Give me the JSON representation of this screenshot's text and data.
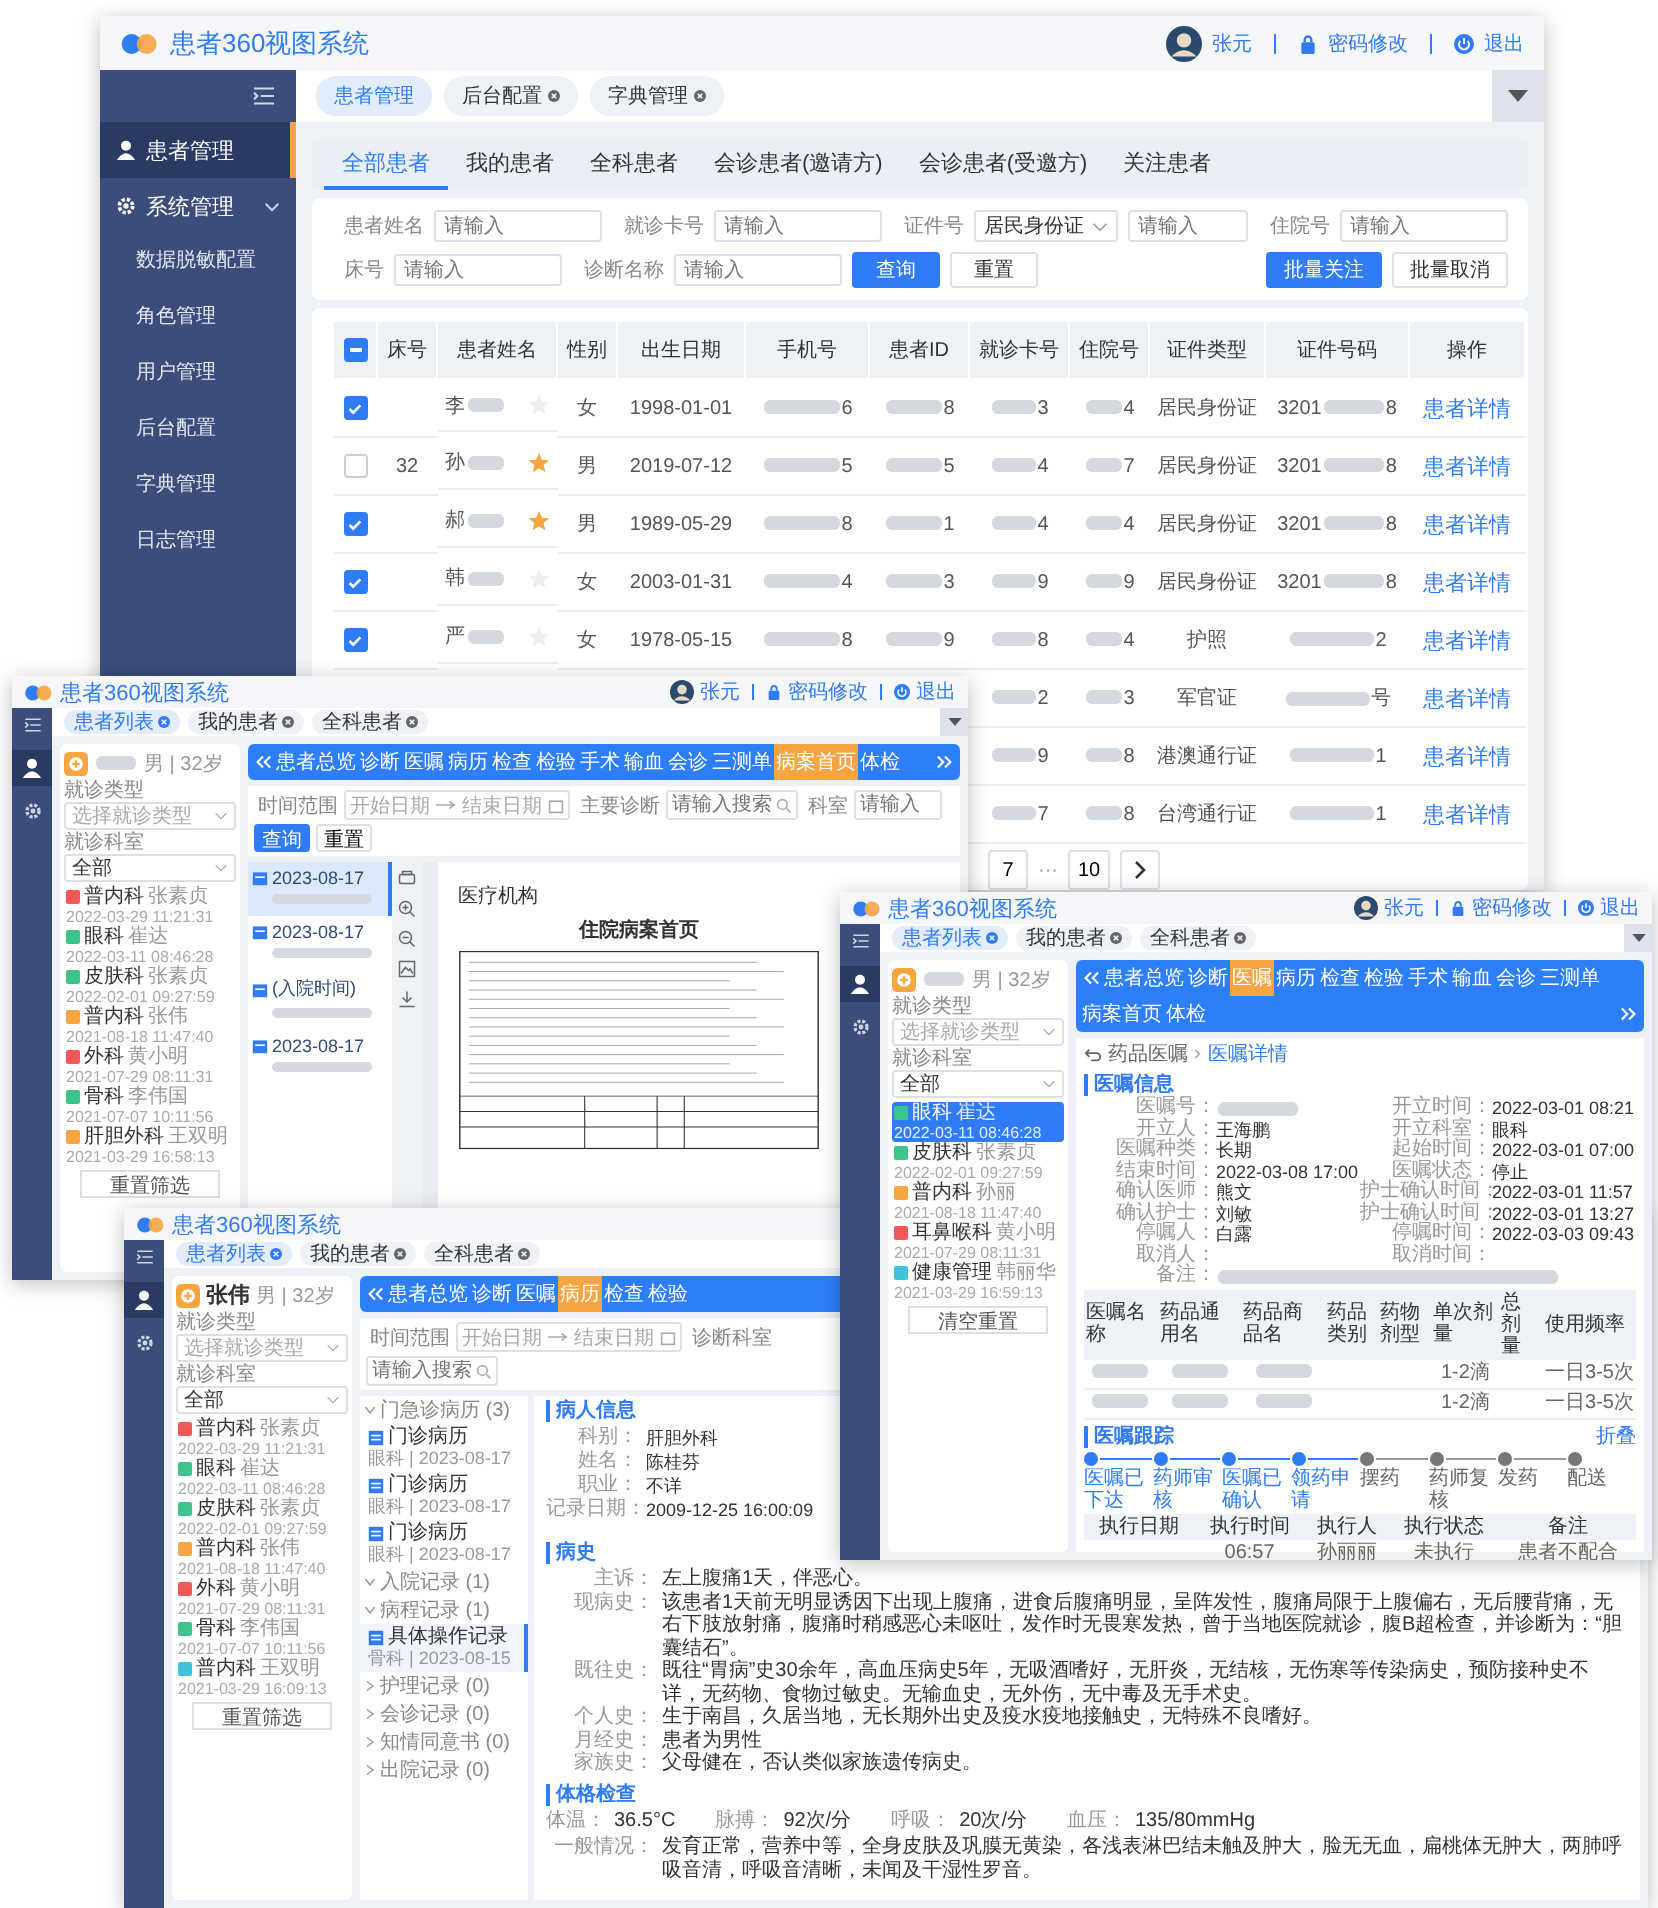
{
  "main_window": {
    "title": "患者360视图系统",
    "user": {
      "name": "张元",
      "links": [
        {
          "label": "密码修改",
          "kind": "password"
        },
        {
          "label": "退出",
          "kind": "logout"
        }
      ]
    },
    "sidebar": [
      {
        "label": "患者管理",
        "kind": "user",
        "selected": true
      },
      {
        "label": "系统管理",
        "kind": "gear",
        "selected": false,
        "expanded": true,
        "children": [
          {
            "label": "数据脱敏配置",
            "selected": false
          },
          {
            "label": "角色管理",
            "selected": false
          },
          {
            "label": "用户管理",
            "selected": false
          },
          {
            "label": "后台配置",
            "selected": false
          },
          {
            "label": "字典管理",
            "selected": false
          },
          {
            "label": "日志管理",
            "selected": false
          }
        ]
      }
    ],
    "tabs": [
      {
        "label": "患者管理",
        "selected": true,
        "closable": false
      },
      {
        "label": "后台配置",
        "selected": false,
        "closable": true
      },
      {
        "label": "字典管理",
        "selected": false,
        "closable": true
      }
    ],
    "subtabs": [
      {
        "label": "全部患者",
        "selected": true
      },
      {
        "label": "我的患者",
        "selected": false
      },
      {
        "label": "全科患者",
        "selected": false
      },
      {
        "label": "会诊患者(邀请方)",
        "selected": false
      },
      {
        "label": "会诊患者(受邀方)",
        "selected": false
      },
      {
        "label": "关注患者",
        "selected": false
      }
    ],
    "filter_rows": [
      [
        {
          "label": "患者姓名",
          "placeholder": "请输入"
        },
        {
          "label": "就诊卡号",
          "placeholder": "请输入"
        },
        {
          "label": "证件号",
          "select": "居民身份证",
          "placeholder": "请输入"
        },
        {
          "label": "住院号",
          "placeholder": "请输入"
        }
      ],
      [
        {
          "label": "床号",
          "placeholder": "请输入"
        },
        {
          "label": "诊断名称",
          "placeholder": "请输入"
        }
      ]
    ],
    "buttons": [
      {
        "label": "查询",
        "kind": "primary"
      },
      {
        "label": "重置",
        "kind": "plain"
      }
    ],
    "bulk_buttons": [
      {
        "label": "批量关注",
        "kind": "primary"
      },
      {
        "label": "批量取消",
        "kind": "plain"
      }
    ],
    "table": {
      "select_all_indeterminate": true,
      "columns": [
        "床号",
        "患者姓名",
        "性别",
        "出生日期",
        "手机号",
        "患者ID",
        "就诊卡号",
        "住院号",
        "证件类型",
        "证件号码",
        "操作"
      ],
      "rows": [
        {
          "checked": true,
          "name": "李",
          "starred": false,
          "gender": "女",
          "birth": "1998-01-01",
          "phone": "6",
          "pid": "8",
          "card": "3",
          "inpatient": "4",
          "id_type": "居民身份证",
          "id_pre": "3201",
          "id_suf": "8",
          "action": "患者详情"
        },
        {
          "checked": false,
          "bed": "32",
          "name": "孙",
          "starred": true,
          "gender": "男",
          "birth": "2019-07-12",
          "phone": "5",
          "pid": "5",
          "card": "4",
          "inpatient": "7",
          "id_type": "居民身份证",
          "id_pre": "3201",
          "id_suf": "8",
          "action": "患者详情"
        },
        {
          "checked": true,
          "name": "郝",
          "starred": true,
          "gender": "男",
          "birth": "1989-05-29",
          "phone": "8",
          "pid": "1",
          "card": "4",
          "inpatient": "4",
          "id_type": "居民身份证",
          "id_pre": "3201",
          "id_suf": "8",
          "action": "患者详情"
        },
        {
          "checked": true,
          "name": "韩",
          "starred": false,
          "gender": "女",
          "birth": "2003-01-31",
          "phone": "4",
          "pid": "3",
          "card": "9",
          "inpatient": "9",
          "id_type": "居民身份证",
          "id_pre": "3201",
          "id_suf": "8",
          "action": "患者详情"
        },
        {
          "checked": true,
          "name": "严",
          "starred": false,
          "gender": "女",
          "birth": "1978-05-15",
          "phone": "8",
          "pid": "9",
          "card": "8",
          "inpatient": "4",
          "id_type": "护照",
          "id_suf": "2",
          "action": "患者详情"
        },
        {
          "card": "2",
          "inpatient": "3",
          "id_type": "军官证",
          "id_suf": "号",
          "action": "患者详情"
        },
        {
          "card": "9",
          "inpatient": "8",
          "id_type": "港澳通行证",
          "id_suf": "1",
          "action": "患者详情"
        },
        {
          "card": "7",
          "inpatient": "8",
          "id_type": "台湾通行证",
          "id_suf": "1",
          "action": "患者详情"
        }
      ]
    },
    "pagination": [
      {
        "label": "7",
        "kind": "page"
      },
      {
        "label": "···",
        "kind": "ellipsis"
      },
      {
        "label": "10",
        "kind": "page"
      }
    ]
  },
  "sub_windows": [
    {
      "kind": "front_page",
      "title": "患者360视图系统",
      "user": "张元",
      "links": [
        {
          "label": "密码修改",
          "kind": "password"
        },
        {
          "label": "退出",
          "kind": "logout"
        }
      ],
      "tabs": [
        {
          "label": "患者列表",
          "selected": true
        },
        {
          "label": "我的患者",
          "selected": false
        },
        {
          "label": "全科患者",
          "selected": false
        }
      ],
      "patient": {
        "info": "男 | 32岁"
      },
      "visit_filters": [
        {
          "label": "就诊类型",
          "placeholder": "选择就诊类型"
        },
        {
          "label": "就诊科室",
          "value": "全部"
        }
      ],
      "visits": [
        {
          "dept": "普内科",
          "doctor": "张素贞",
          "time": "2022-03-29 11:21:31",
          "color": "#f25858",
          "selected": false
        },
        {
          "dept": "眼科",
          "doctor": "崔达",
          "time": "2022-03-11 08:46:28",
          "color": "#3cc48a",
          "selected": false
        },
        {
          "dept": "皮肤科",
          "doctor": "张素贞",
          "time": "2022-02-01 09:27:59",
          "color": "#3cc48a",
          "selected": false
        },
        {
          "dept": "普内科",
          "doctor": "张伟",
          "time": "2021-08-18 11:47:40",
          "color": "#f7a541",
          "selected": false
        },
        {
          "dept": "外科",
          "doctor": "黄小明",
          "time": "2021-07-29 08:11:31",
          "color": "#f25858",
          "selected": false
        },
        {
          "dept": "骨科",
          "doctor": "李伟国",
          "time": "2021-07-07 10:11:56",
          "color": "#3cc48a",
          "selected": false
        },
        {
          "dept": "肝胆外科",
          "doctor": "王双明",
          "time": "2021-03-29 16:58:13",
          "color": "#f7a541",
          "selected": false
        }
      ],
      "reset": "重置筛选",
      "scroll_prev": true,
      "scroll_next": true,
      "nav": [
        {
          "label": "患者总览",
          "selected": false
        },
        {
          "label": "诊断",
          "selected": false
        },
        {
          "label": "医嘱",
          "selected": false
        },
        {
          "label": "病历",
          "selected": false
        },
        {
          "label": "检查",
          "selected": false
        },
        {
          "label": "检验",
          "selected": false
        },
        {
          "label": "手术",
          "selected": false
        },
        {
          "label": "输血",
          "selected": false
        },
        {
          "label": "会诊",
          "selected": false
        },
        {
          "label": "三测单",
          "selected": false
        },
        {
          "label": "病案首页",
          "selected": true
        },
        {
          "label": "体检",
          "selected": false
        }
      ],
      "filters": [
        {
          "label": "时间范围",
          "kind": "range",
          "start": "开始日期",
          "end": "结束日期"
        },
        {
          "label": "主要诊断",
          "kind": "search",
          "placeholder": "请输入搜索"
        },
        {
          "label": "科室",
          "kind": "text",
          "placeholder": "请输入"
        }
      ],
      "actions": [
        {
          "label": "查询",
          "kind": "primary"
        },
        {
          "label": "重置",
          "kind": "plain"
        }
      ],
      "records": [
        {
          "date": "2023-08-17",
          "selected": true
        },
        {
          "date": "2023-08-17",
          "selected": false
        },
        {
          "date": "(入院时间)",
          "selected": false
        },
        {
          "date": "2023-08-17",
          "selected": false
        }
      ],
      "document": {
        "org_label": "医疗机构",
        "title": "住院病案首页"
      }
    },
    {
      "kind": "order_detail",
      "title": "患者360视图系统",
      "user": "张元",
      "links": [
        {
          "label": "密码修改",
          "kind": "password"
        },
        {
          "label": "退出",
          "kind": "logout"
        }
      ],
      "tabs": [
        {
          "label": "患者列表",
          "selected": true
        },
        {
          "label": "我的患者",
          "selected": false
        },
        {
          "label": "全科患者",
          "selected": false
        }
      ],
      "patient": {
        "info": "男 | 32岁"
      },
      "visit_filters": [
        {
          "label": "就诊类型",
          "placeholder": "选择就诊类型"
        },
        {
          "label": "就诊科室",
          "value": "全部"
        }
      ],
      "visits": [
        {
          "dept": "眼科",
          "doctor": "崔达",
          "time": "2022-03-11 08:46:28",
          "color": "#3cc48a",
          "selected": true
        },
        {
          "dept": "皮肤科",
          "doctor": "张素贞",
          "time": "2022-02-01 09:27:59",
          "color": "#3cc48a",
          "selected": false
        },
        {
          "dept": "普内科",
          "doctor": "孙丽",
          "time": "2021-08-18 11:47:40",
          "color": "#f7a541",
          "selected": false
        },
        {
          "dept": "耳鼻喉科",
          "doctor": "黄小明",
          "time": "2021-07-29 08:11:31",
          "color": "#f25858",
          "selected": false
        },
        {
          "dept": "健康管理",
          "doctor": "韩丽华",
          "time": "2021-03-29 16:59:13",
          "color": "#3cc4d8",
          "selected": false
        }
      ],
      "reset": "清空重置",
      "scroll_prev": true,
      "scroll_next": true,
      "nav": [
        {
          "label": "患者总览",
          "selected": false
        },
        {
          "label": "诊断",
          "selected": false
        },
        {
          "label": "医嘱",
          "selected": true
        },
        {
          "label": "病历",
          "selected": false
        },
        {
          "label": "检查",
          "selected": false
        },
        {
          "label": "检验",
          "selected": false
        },
        {
          "label": "手术",
          "selected": false
        },
        {
          "label": "输血",
          "selected": false
        },
        {
          "label": "会诊",
          "selected": false
        },
        {
          "label": "三测单",
          "selected": false
        },
        {
          "label": "病案首页",
          "selected": false
        },
        {
          "label": "体检",
          "selected": false
        }
      ],
      "breadcrumb": [
        "药品医嘱",
        "医嘱详情"
      ],
      "order_info": {
        "title": "医嘱信息",
        "fields": [
          {
            "label": "医嘱号：",
            "masked": true
          },
          {
            "label": "开立时间：",
            "value": "2022-03-01 08:21"
          },
          {
            "label": "开立人：",
            "value": "王海鹏"
          },
          {
            "label": "开立科室：",
            "value": "眼科"
          },
          {
            "label": "医嘱种类：",
            "value": "长期"
          },
          {
            "label": "起始时间：",
            "value": "2022-03-01 07:00"
          },
          {
            "label": "结束时间：",
            "value": "2022-03-08 17:00"
          },
          {
            "label": "医嘱状态：",
            "value": "停止"
          },
          {
            "label": "确认医师：",
            "value": "熊文"
          },
          {
            "label": "护士确认时间：",
            "value": "2022-03-01 11:57"
          },
          {
            "label": "确认护士：",
            "value": "刘敏"
          },
          {
            "label": "护士确认时间：",
            "value": "2022-03-01 13:27"
          },
          {
            "label": "停嘱人：",
            "value": "白露"
          },
          {
            "label": "停嘱时间：",
            "value": "2022-03-03 09:43"
          },
          {
            "label": "取消人："
          },
          {
            "label": "取消时间："
          },
          {
            "label": "备注：",
            "masked": true,
            "wide": true
          }
        ]
      },
      "med_table": {
        "columns": [
          "医嘱名称",
          "药品通用名",
          "药品商品名",
          "药品类别",
          "药物剂型",
          "单次剂量",
          "总剂量",
          "使用频率"
        ],
        "rows": [
          {
            "dose": "1-2滴",
            "frequency": "一日3-5次"
          },
          {
            "dose": "1-2滴",
            "frequency": "一日3-5次"
          }
        ]
      },
      "tracking": {
        "title": "医嘱跟踪",
        "toggle": "折叠",
        "steps": [
          {
            "label": "医嘱已下达",
            "done": true
          },
          {
            "label": "药师审核",
            "done": true
          },
          {
            "label": "医嘱已确认",
            "done": true
          },
          {
            "label": "领药申请",
            "done": true
          },
          {
            "label": "摆药",
            "done": false
          },
          {
            "label": "药师复核",
            "done": false
          },
          {
            "label": "发药",
            "done": false
          },
          {
            "label": "配送",
            "done": false
          }
        ]
      },
      "exec_table": {
        "columns": [
          "执行日期",
          "执行时间",
          "执行人",
          "执行状态",
          "备注"
        ],
        "rows": [
          {
            "time": "06:57",
            "by": "孙丽丽",
            "status": "未执行",
            "note": "患者不配合"
          }
        ]
      }
    },
    {
      "kind": "medical_record",
      "title": "患者360视图系统",
      "tabs": [
        {
          "label": "患者列表",
          "selected": true
        },
        {
          "label": "我的患者",
          "selected": false
        },
        {
          "label": "全科患者",
          "selected": false
        }
      ],
      "patient": {
        "name": "张伟",
        "info": "男 | 32岁"
      },
      "visit_filters": [
        {
          "label": "就诊类型",
          "placeholder": "选择就诊类型"
        },
        {
          "label": "就诊科室",
          "value": "全部"
        }
      ],
      "visits": [
        {
          "dept": "普内科",
          "doctor": "张素贞",
          "time": "2022-03-29 11:21:31",
          "color": "#f25858",
          "selected": false
        },
        {
          "dept": "眼科",
          "doctor": "崔达",
          "time": "2022-03-11 08:46:28",
          "color": "#3cc48a",
          "selected": false
        },
        {
          "dept": "皮肤科",
          "doctor": "张素贞",
          "time": "2022-02-01 09:27:59",
          "color": "#3cc48a",
          "selected": false
        },
        {
          "dept": "普内科",
          "doctor": "张伟",
          "time": "2021-08-18 11:47:40",
          "color": "#f7a541",
          "selected": false
        },
        {
          "dept": "外科",
          "doctor": "黄小明",
          "time": "2021-07-29 08:11:31",
          "color": "#f25858",
          "selected": false
        },
        {
          "dept": "骨科",
          "doctor": "李伟国",
          "time": "2021-07-07 10:11:56",
          "color": "#3cc48a",
          "selected": false
        },
        {
          "dept": "普内科",
          "doctor": "王双明",
          "time": "2021-03-29 16:09:13",
          "color": "#3cc4d8",
          "selected": false
        }
      ],
      "reset": "重置筛选",
      "scroll_prev": true,
      "nav": [
        {
          "label": "患者总览",
          "selected": false
        },
        {
          "label": "诊断",
          "selected": false
        },
        {
          "label": "医嘱",
          "selected": false
        },
        {
          "label": "病历",
          "selected": true
        },
        {
          "label": "检查",
          "selected": false
        },
        {
          "label": "检验",
          "selected": false
        }
      ],
      "filters": [
        {
          "label": "时间范围",
          "kind": "range",
          "start": "开始日期",
          "end": "结束日期"
        },
        {
          "label": "诊断科室",
          "kind": "search",
          "placeholder": "请输入搜索"
        }
      ],
      "tree": [
        {
          "label": "门急诊病历",
          "count": "(3)",
          "expanded": true,
          "children": [
            {
              "title": "门诊病历",
              "sub": "眼科 | 2023-08-17",
              "selected": false
            },
            {
              "title": "门诊病历",
              "sub": "眼科 | 2023-08-17",
              "selected": false
            },
            {
              "title": "门诊病历",
              "sub": "眼科 | 2023-08-17",
              "selected": false
            }
          ]
        },
        {
          "label": "入院记录",
          "count": "(1)",
          "expanded": true
        },
        {
          "label": "病程记录",
          "count": "(1)",
          "expanded": true,
          "children": [
            {
              "title": "具体操作记录",
              "sub": "骨科 | 2023-08-15",
              "selected": true
            }
          ]
        },
        {
          "label": "护理记录",
          "count": "(0)",
          "expanded": false
        },
        {
          "label": "会诊记录",
          "count": "(0)",
          "expanded": false
        },
        {
          "label": "知情同意书",
          "count": "(0)",
          "expanded": false
        },
        {
          "label": "出院记录",
          "count": "(0)",
          "expanded": false
        }
      ],
      "sections": [
        {
          "title": "病人信息",
          "kind": "grid",
          "fields": [
            {
              "label": "科别：",
              "value": "肝胆外科"
            },
            {
              "label": "姓名：",
              "value": "陈桂芬"
            },
            {
              "label": "职业：",
              "value": "不详"
            },
            {
              "label": "记录日期：",
              "value": "2009-12-25 16:00:09"
            }
          ]
        },
        {
          "title": "病史",
          "kind": "list",
          "fields": [
            {
              "label": "主诉：",
              "value": "左上腹痛1天，伴恶心。"
            },
            {
              "label": "现病史：",
              "value": "该患者1天前无明显诱因下出现上腹痛，进食后腹痛明显，呈阵发性，腹痛局限于上腹偏右，无后腰背痛，无右下肢放射痛，腹痛时稍感恶心未呕吐，发作时无畏寒发热，曾于当地医院就诊，腹B超检查，并诊断为：“胆囊结石”。"
            },
            {
              "label": "既往史：",
              "value": "既往“胃病”史30余年，高血压病史5年，无吸酒嗜好，无肝炎，无结核，无伤寒等传染病史，预防接种史不详，无药物、食物过敏史。无输血史，无外伤，无中毒及无手术史。"
            },
            {
              "label": "个人史：",
              "value": "生于南昌，久居当地，无长期外出史及疫水疫地接触史，无特殊不良嗜好。"
            },
            {
              "label": "月经史：",
              "value": "患者为男性"
            },
            {
              "label": "家族史：",
              "value": "父母健在，否认类似家族遗传病史。"
            }
          ]
        },
        {
          "title": "体格检查",
          "kind": "vitals",
          "vitals": [
            {
              "label": "体温：",
              "value": "36.5°C"
            },
            {
              "label": "脉搏：",
              "value": "92次/分"
            },
            {
              "label": "呼吸：",
              "value": "20次/分"
            },
            {
              "label": "血压：",
              "value": "135/80mmHg"
            }
          ],
          "fields": [
            {
              "label": "一般情况：",
              "value": "发育正常，营养中等，全身皮肤及巩膜无黄染，各浅表淋巴结未触及肿大，脸无无血，扁桃体无肿大，两肺呼吸音清，呼吸音清晰，未闻及干湿性罗音。"
            }
          ]
        }
      ]
    }
  ]
}
